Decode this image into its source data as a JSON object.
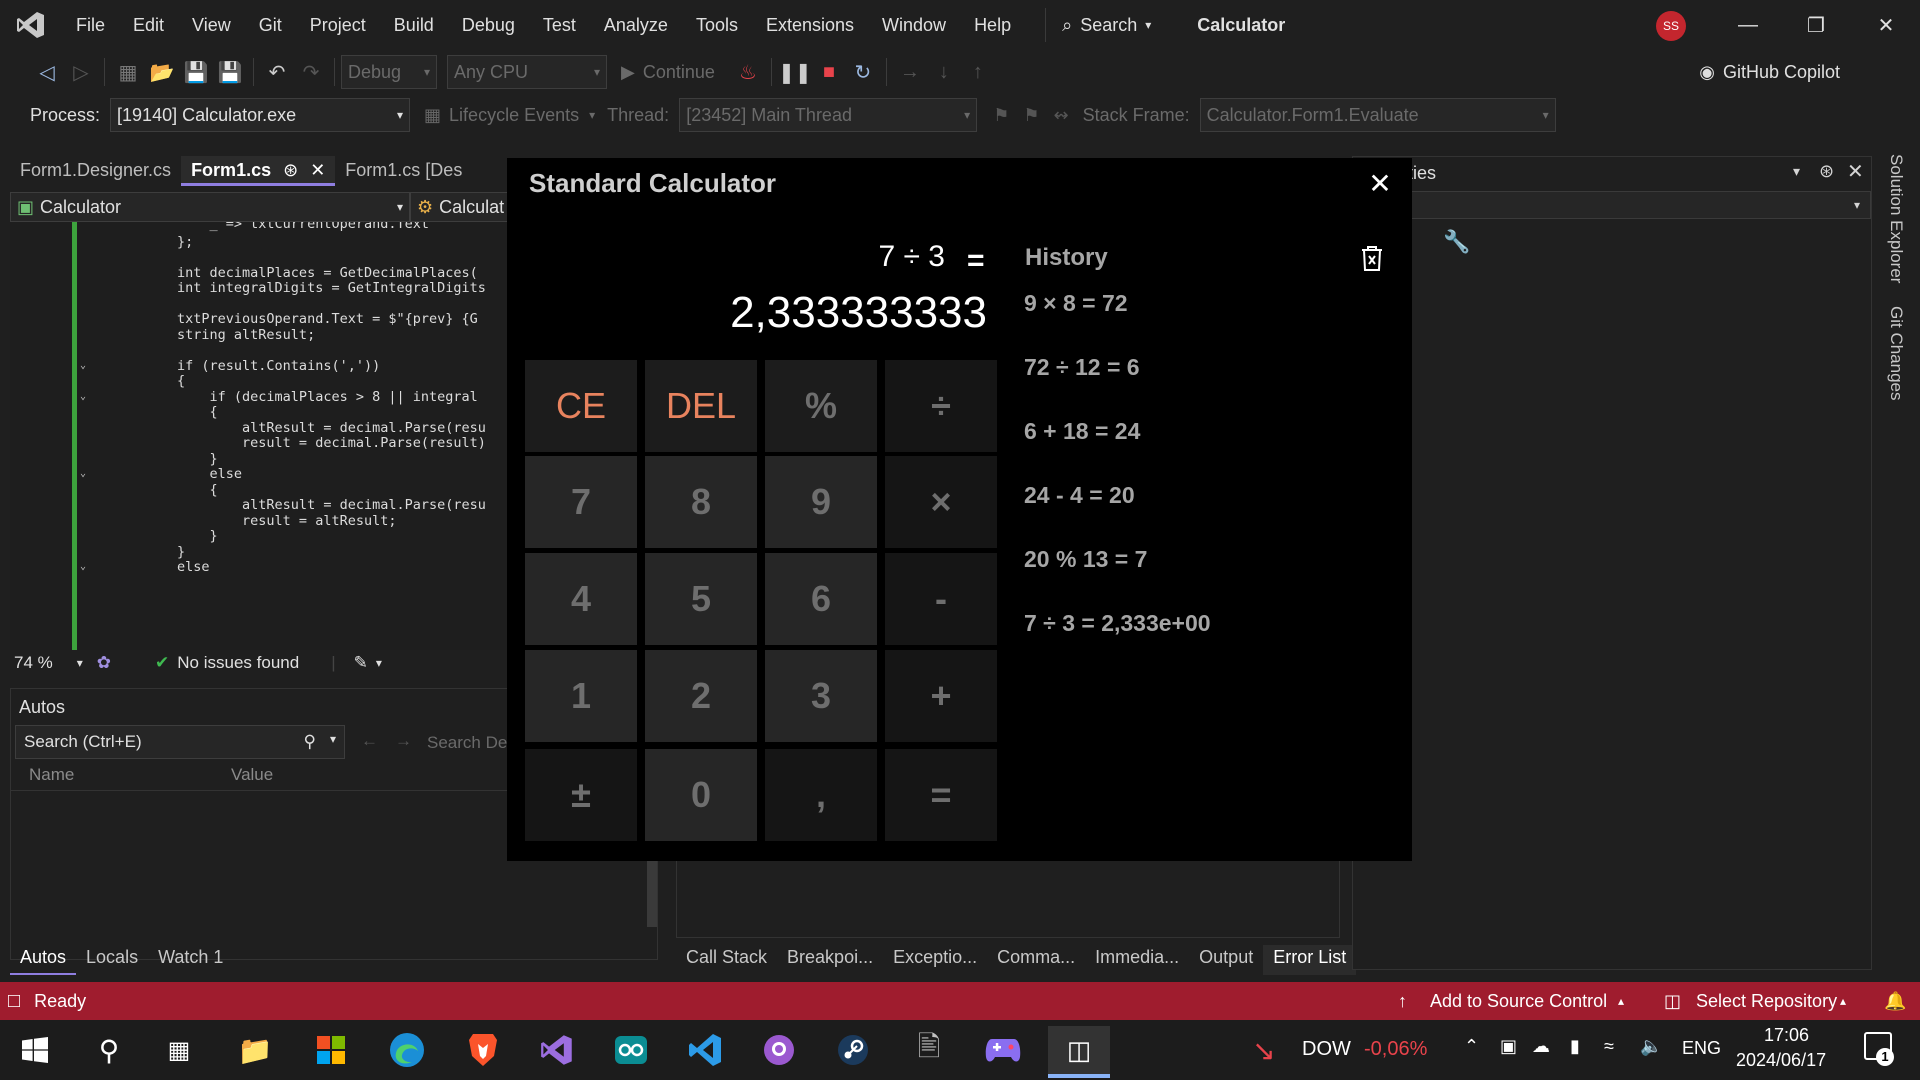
{
  "menubar": {
    "items": [
      "File",
      "Edit",
      "View",
      "Git",
      "Project",
      "Build",
      "Debug",
      "Test",
      "Analyze",
      "Tools",
      "Extensions",
      "Window",
      "Help"
    ],
    "search_label": "Search",
    "title": "Calculator",
    "avatar_initials": "SS"
  },
  "toolbar1": {
    "config": "Debug",
    "platform": "Any CPU",
    "continue_label": "Continue",
    "copilot_label": "GitHub Copilot"
  },
  "toolbar2": {
    "process_label": "Process:",
    "process_value": "[19140] Calculator.exe",
    "lifecycle_label": "Lifecycle Events",
    "thread_label": "Thread:",
    "thread_value": "[23452] Main Thread",
    "stackframe_label": "Stack Frame:",
    "stackframe_value": "Calculator.Form1.Evaluate"
  },
  "doctabs": {
    "tab1": "Form1.Designer.cs",
    "tab2": "Form1.cs",
    "tab3": "Form1.cs [Des"
  },
  "navbar": {
    "project": "Calculator",
    "member": "Calculat"
  },
  "code": {
    "lines": [
      "            _ => txtCurrentOperand.Text",
      "        };",
      "",
      "        int decimalPlaces = GetDecimalPlaces(",
      "        int integralDigits = GetIntegralDigits",
      "",
      "        txtPreviousOperand.Text = $\"{prev} {G",
      "        string altResult;",
      "",
      "        if (result.Contains(','))",
      "        {",
      "            if (decimalPlaces > 8 || integral",
      "            {",
      "                altResult = decimal.Parse(resu",
      "                result = decimal.Parse(result)",
      "            }",
      "            else",
      "            {",
      "                altResult = decimal.Parse(resu",
      "                result = altResult;",
      "            }",
      "        }",
      "        else"
    ]
  },
  "editstatus": {
    "zoom": "74 %",
    "issues": "No issues found"
  },
  "autos": {
    "title": "Autos",
    "search_placeholder": "Search (Ctrl+E)",
    "search_depth": "Search De",
    "col_name": "Name",
    "col_value": "Value"
  },
  "bottomtabs_left": [
    "Autos",
    "Locals",
    "Watch 1"
  ],
  "bottomtabs_right": [
    "Call Stack",
    "Breakpoi...",
    "Exceptio...",
    "Comma...",
    "Immedia...",
    "Output",
    "Error List"
  ],
  "rightpanel": {
    "title": "ties"
  },
  "sidestrip": {
    "solution_explorer": "Solution Explorer",
    "git_changes": "Git Changes"
  },
  "statusbar": {
    "ready": "Ready",
    "add_source": "Add to Source Control",
    "select_repo": "Select Repository"
  },
  "taskbar": {
    "ticker": "DOW",
    "change": "-0,06%",
    "lang": "ENG",
    "time": "17:06",
    "date": "2024/06/17",
    "notif_count": "1"
  },
  "calculator": {
    "title": "Standard Calculator",
    "expression": "7 ÷ 3",
    "equals": "=",
    "result": "2,333333333",
    "keys": [
      [
        "CE",
        "DEL",
        "%",
        "÷"
      ],
      [
        "7",
        "8",
        "9",
        "×"
      ],
      [
        "4",
        "5",
        "6",
        "-"
      ],
      [
        "1",
        "2",
        "3",
        "+"
      ],
      [
        "±",
        "0",
        ",",
        "="
      ]
    ],
    "history_title": "History",
    "history": [
      "9 × 8 = 72",
      "72 ÷ 12 = 6",
      "6 + 18 = 24",
      "24 - 4 = 20",
      "20 % 13 = 7",
      "7 ÷ 3 = 2,333e+00"
    ]
  },
  "colors": {
    "accent": "#8f7ee0",
    "statusbar": "#9f1c2e",
    "calc_red": "#e8835e"
  }
}
